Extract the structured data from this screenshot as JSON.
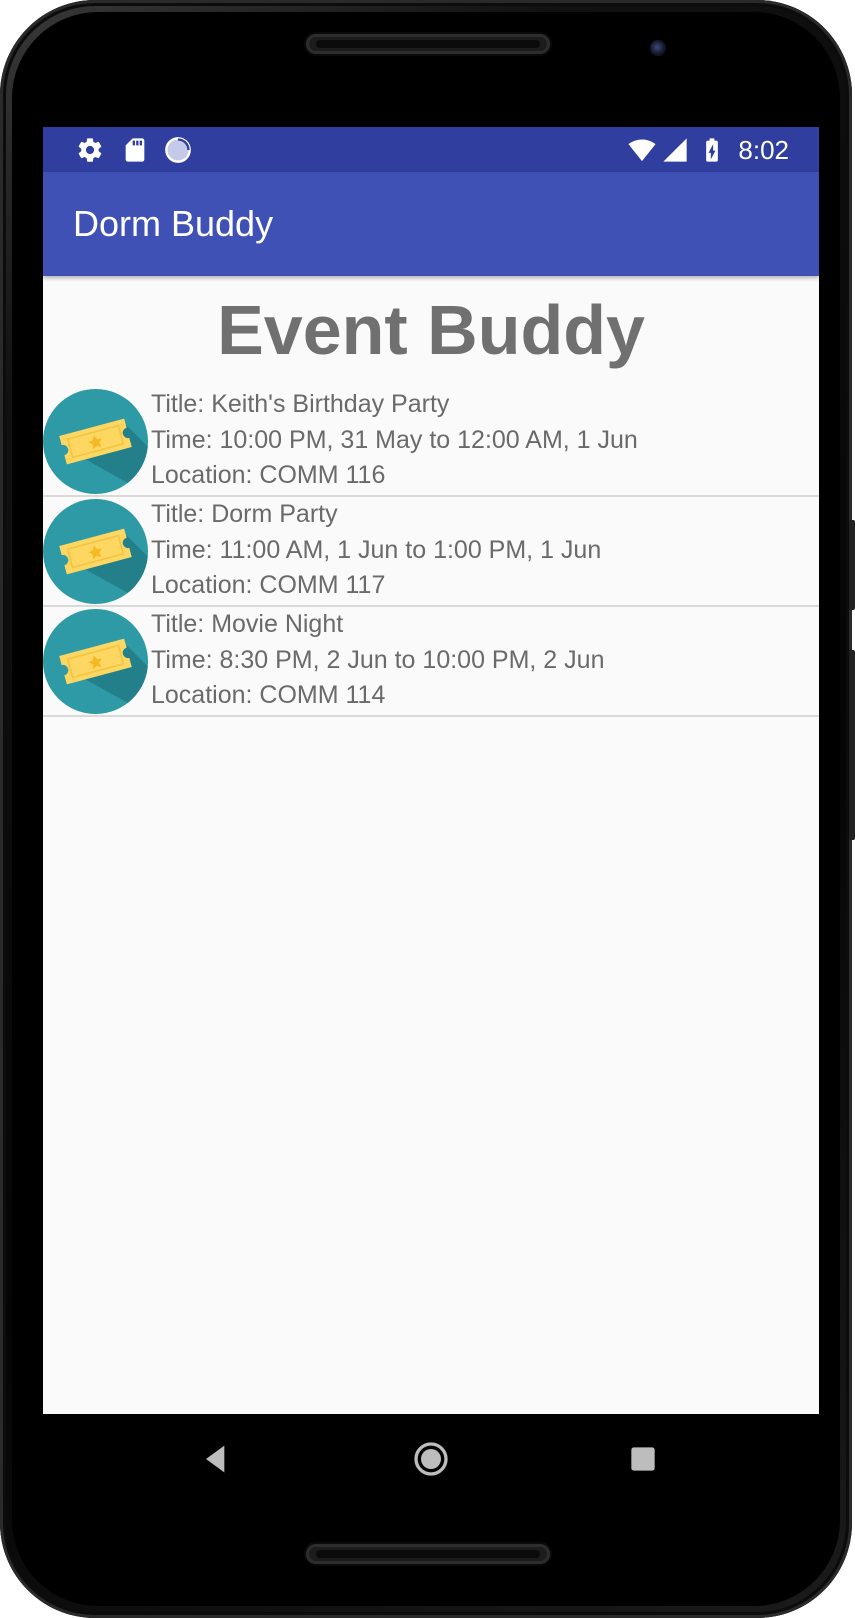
{
  "status_bar": {
    "time": "8:02",
    "icons": [
      "gear-icon",
      "sd-card-icon",
      "loading-circle-icon",
      "wifi-icon",
      "cell-signal-icon",
      "battery-charging-icon"
    ]
  },
  "app_bar": {
    "title": "Dorm Buddy"
  },
  "main": {
    "heading": "Event Buddy",
    "events": [
      {
        "title": "Title: Keith's Birthday Party",
        "time": "Time: 10:00 PM, 31 May to 12:00 AM, 1 Jun",
        "location": "Location: COMM 116",
        "icon": "ticket-icon"
      },
      {
        "title": "Title: Dorm Party",
        "time": "Time: 11:00 AM, 1 Jun to 1:00 PM, 1 Jun",
        "location": "Location: COMM 117",
        "icon": "ticket-icon"
      },
      {
        "title": "Title: Movie Night",
        "time": "Time: 8:30 PM, 2 Jun to 10:00 PM, 2 Jun",
        "location": "Location: COMM 114",
        "icon": "ticket-icon"
      }
    ]
  },
  "nav_bar": {
    "buttons": [
      "back-icon",
      "home-icon",
      "recents-icon"
    ]
  },
  "colors": {
    "status_bar": "#303f9f",
    "app_bar": "#3f51b5",
    "icon_circle": "#2e9aa6",
    "ticket": "#fdd761",
    "text": "#6a6a6a"
  }
}
